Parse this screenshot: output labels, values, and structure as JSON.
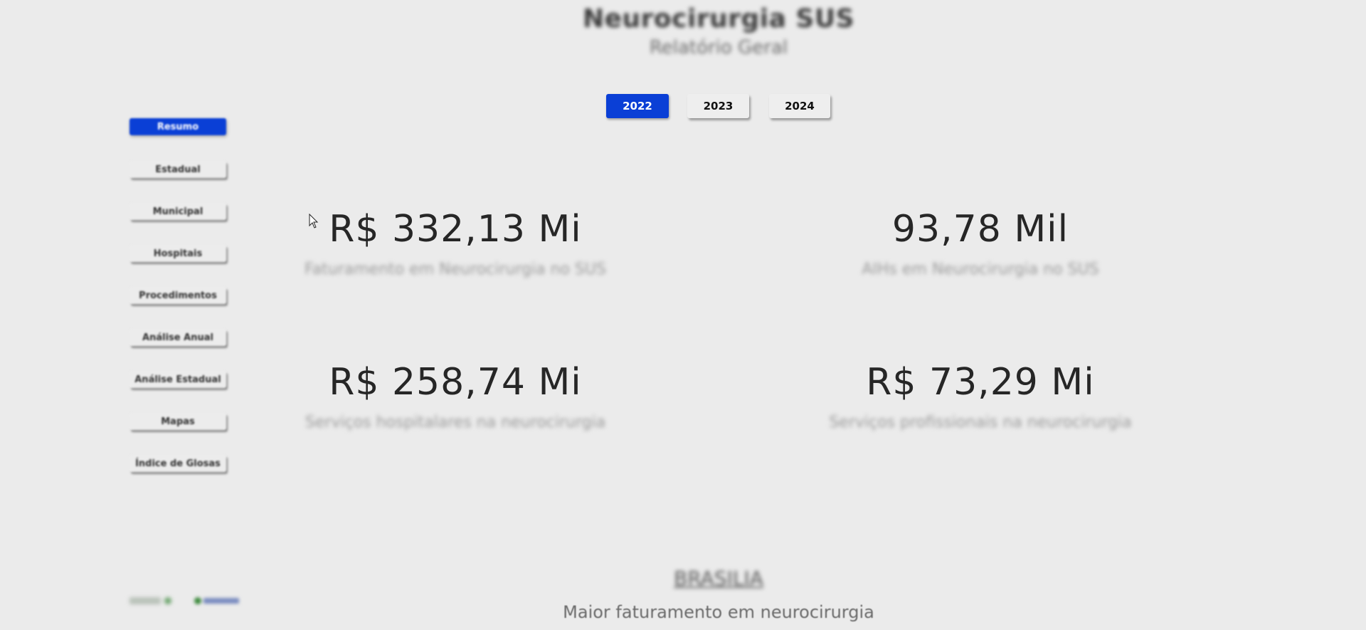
{
  "header": {
    "title": "Neurocirurgia SUS",
    "subtitle": "Relatório Geral"
  },
  "year_filter": {
    "options": [
      "2022",
      "2023",
      "2024"
    ],
    "selected": "2022"
  },
  "sidebar": {
    "items": [
      {
        "label": "Resumo",
        "active": true
      },
      {
        "label": "Estadual",
        "active": false
      },
      {
        "label": "Municipal",
        "active": false
      },
      {
        "label": "Hospitais",
        "active": false
      },
      {
        "label": "Procedimentos",
        "active": false
      },
      {
        "label": "Análise Anual",
        "active": false
      },
      {
        "label": "Análise Estadual",
        "active": false
      },
      {
        "label": "Mapas",
        "active": false
      },
      {
        "label": "Índice de Glosas",
        "active": false
      }
    ]
  },
  "kpis": [
    {
      "value": "R$ 332,13 Mi",
      "label": "Faturamento em Neurocirurgia no SUS"
    },
    {
      "value": "93,78 Mil",
      "label": "AIHs em Neurocirurgia no SUS"
    },
    {
      "value": "R$ 258,74 Mi",
      "label": "Serviços hospitalares na neurocirurgia"
    },
    {
      "value": "R$ 73,29 Mi",
      "label": "Serviços profissionais na neurocirurgia"
    }
  ],
  "footer": {
    "city": "BRASILIA",
    "caption": "Maior faturamento em neurocirurgia"
  },
  "colors": {
    "accent": "#0a3fd6",
    "background": "#ebebeb",
    "kpi_text": "#262626"
  },
  "icons": [
    "mouse-cursor-icon",
    "logo-icon"
  ]
}
